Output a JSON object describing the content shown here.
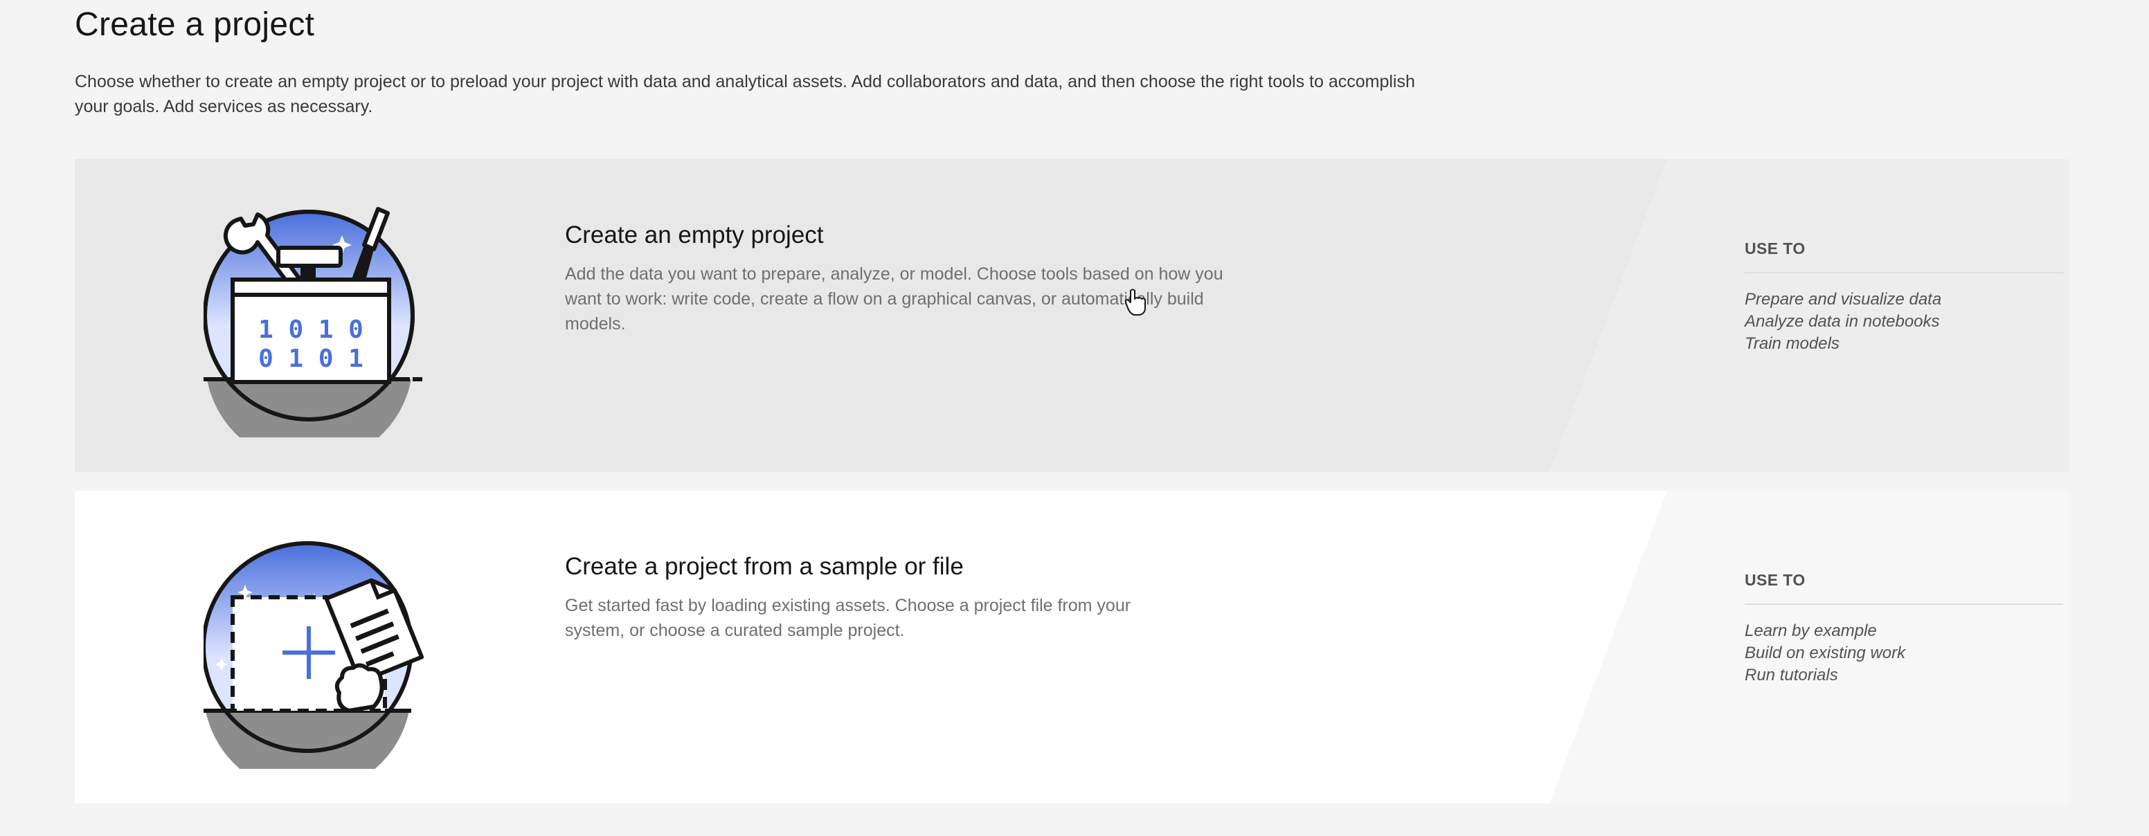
{
  "page": {
    "title": "Create a project",
    "description": "Choose whether to create an empty project or to preload your project with data and analytical assets. Add collaborators and data, and then choose the right tools to accomplish your goals. Add services as necessary."
  },
  "cards": [
    {
      "title": "Create an empty project",
      "description": "Add the data you want to prepare, analyze, or model. Choose tools based on how you want to work: write code, create a flow on a graphical canvas, or automatically build models.",
      "use_to_label": "USE TO",
      "uses": [
        "Prepare and visualize data",
        "Analyze data in notebooks",
        "Train models"
      ],
      "icon": "toolbox-icon",
      "binary_top": "1 0 1 0",
      "binary_bottom": "0 1 0 1"
    },
    {
      "title": "Create a project from a sample or file",
      "description": "Get started fast by loading existing assets. Choose a project file from your system, or choose a curated sample project.",
      "use_to_label": "USE TO",
      "uses": [
        "Learn by example",
        "Build on existing work",
        "Run tutorials"
      ],
      "icon": "file-upload-icon"
    }
  ],
  "colors": {
    "background": "#f4f4f4",
    "card_selected": "#e8e8e8",
    "card_default": "#ffffff",
    "accent_blue": "#4a6fdc"
  },
  "cursor_icon": "hand-pointer-icon"
}
